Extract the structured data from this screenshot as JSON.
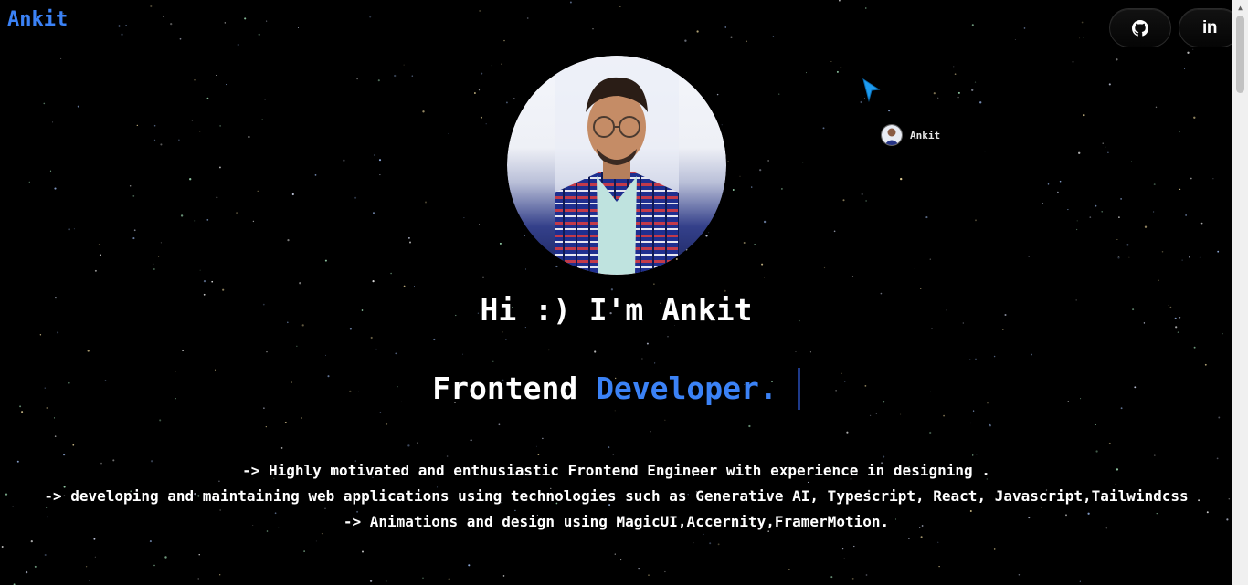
{
  "header": {
    "brand": "Ankit",
    "social": [
      {
        "name": "github",
        "icon": "github-icon"
      },
      {
        "name": "linkedin",
        "label": "in",
        "icon": "linkedin-icon"
      }
    ]
  },
  "cursor_chip": {
    "name": "Ankit"
  },
  "hero": {
    "greeting": "Hi :) I'm Ankit",
    "role_prefix": "Frontend ",
    "role_accent": "Developer.",
    "about": [
      "-> Highly motivated and enthusiastic Frontend Engineer with experience in designing .",
      "-> developing and maintaining web applications using technologies such as Generative AI, Typescript, React, Javascript,Tailwindcss",
      "-> Animations and design using MagicUI,Accernity,FramerMotion."
    ]
  },
  "colors": {
    "background": "#000000",
    "accent": "#3b82f6",
    "text": "#ffffff",
    "caret": "#1e3a8a"
  }
}
